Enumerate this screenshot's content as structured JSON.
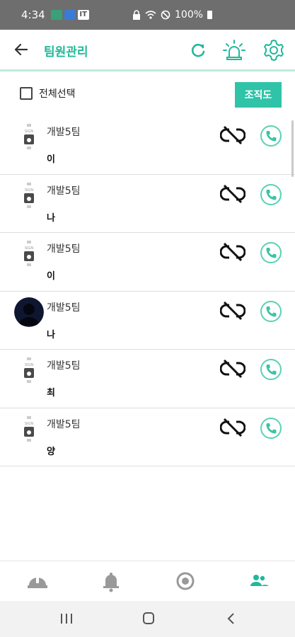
{
  "status_bar": {
    "time": "4:34",
    "battery": "100%",
    "notif_badge": "IT"
  },
  "header": {
    "title": "팀원관리"
  },
  "toolbar": {
    "select_all_label": "전체선택",
    "org_chart_label": "조직도"
  },
  "members": [
    {
      "team": "개발5팀",
      "name": "이",
      "avatar": "sign-logo"
    },
    {
      "team": "개발5팀",
      "name": "나",
      "avatar": "sign-logo"
    },
    {
      "team": "개발5팀",
      "name": "이",
      "avatar": "sign-logo"
    },
    {
      "team": "개발5팀",
      "name": "나",
      "avatar": "photo"
    },
    {
      "team": "개발5팀",
      "name": "최",
      "avatar": "sign-logo"
    },
    {
      "team": "개발5팀",
      "name": "양",
      "avatar": "sign-logo"
    }
  ],
  "icons": {
    "back": "arrow-left-icon",
    "refresh": "refresh-icon",
    "alarm": "siren-icon",
    "settings": "gear-icon",
    "unlink": "link-off-icon",
    "call": "phone-icon",
    "nav": [
      "hardhat-icon",
      "bell-icon",
      "record-icon",
      "team-icon"
    ]
  },
  "colors": {
    "accent": "#21b89a",
    "button": "#2fc3a8",
    "status_bar": "#6e6e6e"
  }
}
